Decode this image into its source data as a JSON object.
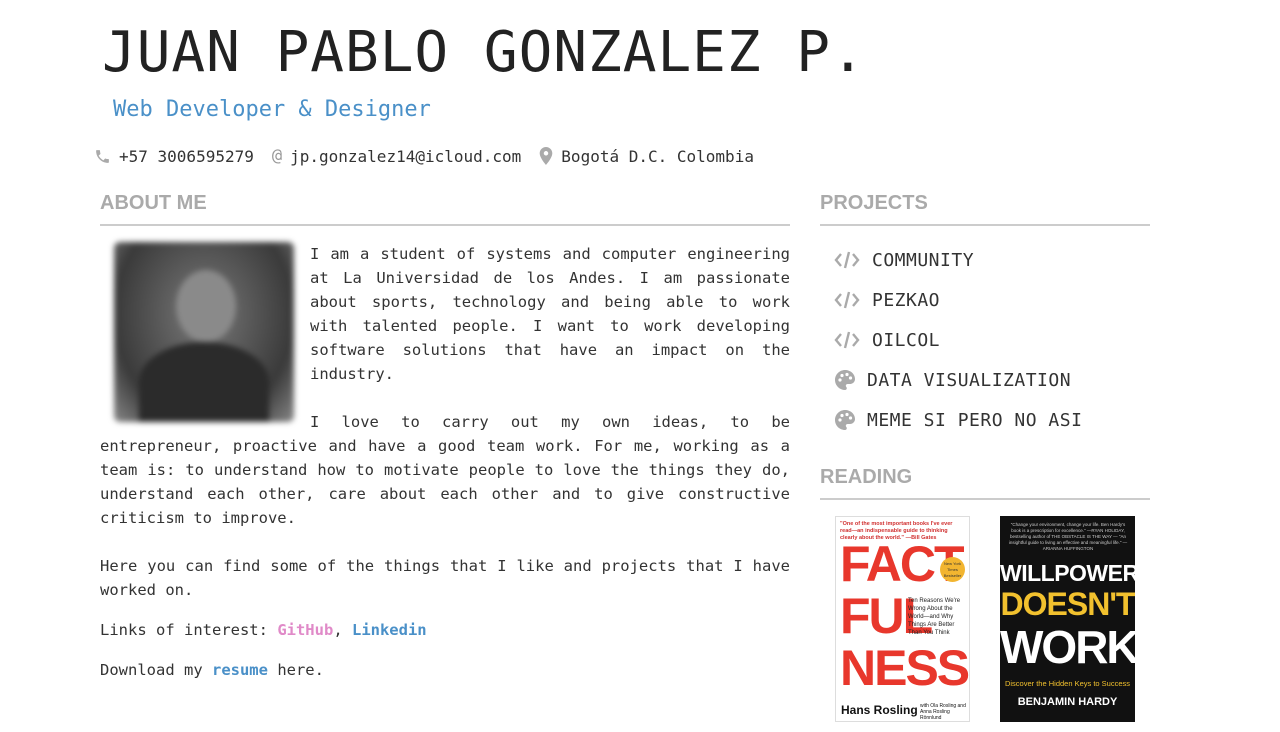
{
  "header": {
    "name": "JUAN PABLO GONZALEZ P.",
    "subtitle": "Web Developer & Designer"
  },
  "contact": {
    "phone": "+57 3006595279",
    "email": "jp.gonzalez14@icloud.com",
    "location": "Bogotá D.C. Colombia"
  },
  "about": {
    "title": "ABOUT ME",
    "paragraph1": "I am a student of systems and computer engineering at La Universidad de los Andes. I am passionate about sports, technology and being able to work with talented people. I want to work developing software solutions that have an impact on the industry.",
    "paragraph2": "I love to carry out my own ideas, to be entrepreneur, proactive and have a good team work. For me, working as a team is: to understand how to motivate people to love the things they do, understand each other, care about each other and to give constructive criticism to improve.",
    "paragraph3": "Here you can find some of the things that I like and projects that I have worked on.",
    "links_prefix": "Links of interest: ",
    "github_label": "GitHub",
    "links_sep": ", ",
    "linkedin_label": "Linkedin",
    "download_prefix": "Download my ",
    "resume_label": "resume",
    "download_suffix": " here."
  },
  "projects": {
    "title": "PROJECTS",
    "items": [
      {
        "label": "COMMUNITY",
        "icon": "code-icon"
      },
      {
        "label": "PEZKAO",
        "icon": "code-icon"
      },
      {
        "label": "OILCOL",
        "icon": "code-icon"
      },
      {
        "label": "DATA VISUALIZATION",
        "icon": "palette-icon"
      },
      {
        "label": "MEME SI PERO NO ASI",
        "icon": "palette-icon"
      }
    ]
  },
  "reading": {
    "title": "READING",
    "book1": {
      "blurb": "\"One of the most important books I've ever read—an indispensable guide to thinking clearly about the world.\" —Bill Gates",
      "title_line1": "FACT",
      "title_line2": "FUL",
      "title_line3": "NESS",
      "subtitle": "Ten Reasons We're Wrong About the World—and Why Things Are Better Than You Think",
      "badge": "New York Times Bestseller",
      "author": "Hans Rosling",
      "coauthors": "with Ola Rosling and Anna Rosling Rönnlund"
    },
    "book2": {
      "blurb": "\"Change your environment, change your life. Ben Hardy's book is a prescription for excellence.\" —RYAN HOLIDAY, bestselling author of THE OBSTACLE IS THE WAY — \"An insightful guide to living an effective and meaningful life.\" —ARIANNA HUFFINGTON",
      "title_line1": "WILLPOWER",
      "title_line2": "DOESN'T",
      "title_line3": "WORK",
      "subtitle": "Discover the Hidden Keys to Success",
      "author": "BENJAMIN HARDY"
    }
  },
  "colors": {
    "accent": "#4a90c8",
    "github": "#e08ac8",
    "section_title": "#aaaaaa"
  }
}
